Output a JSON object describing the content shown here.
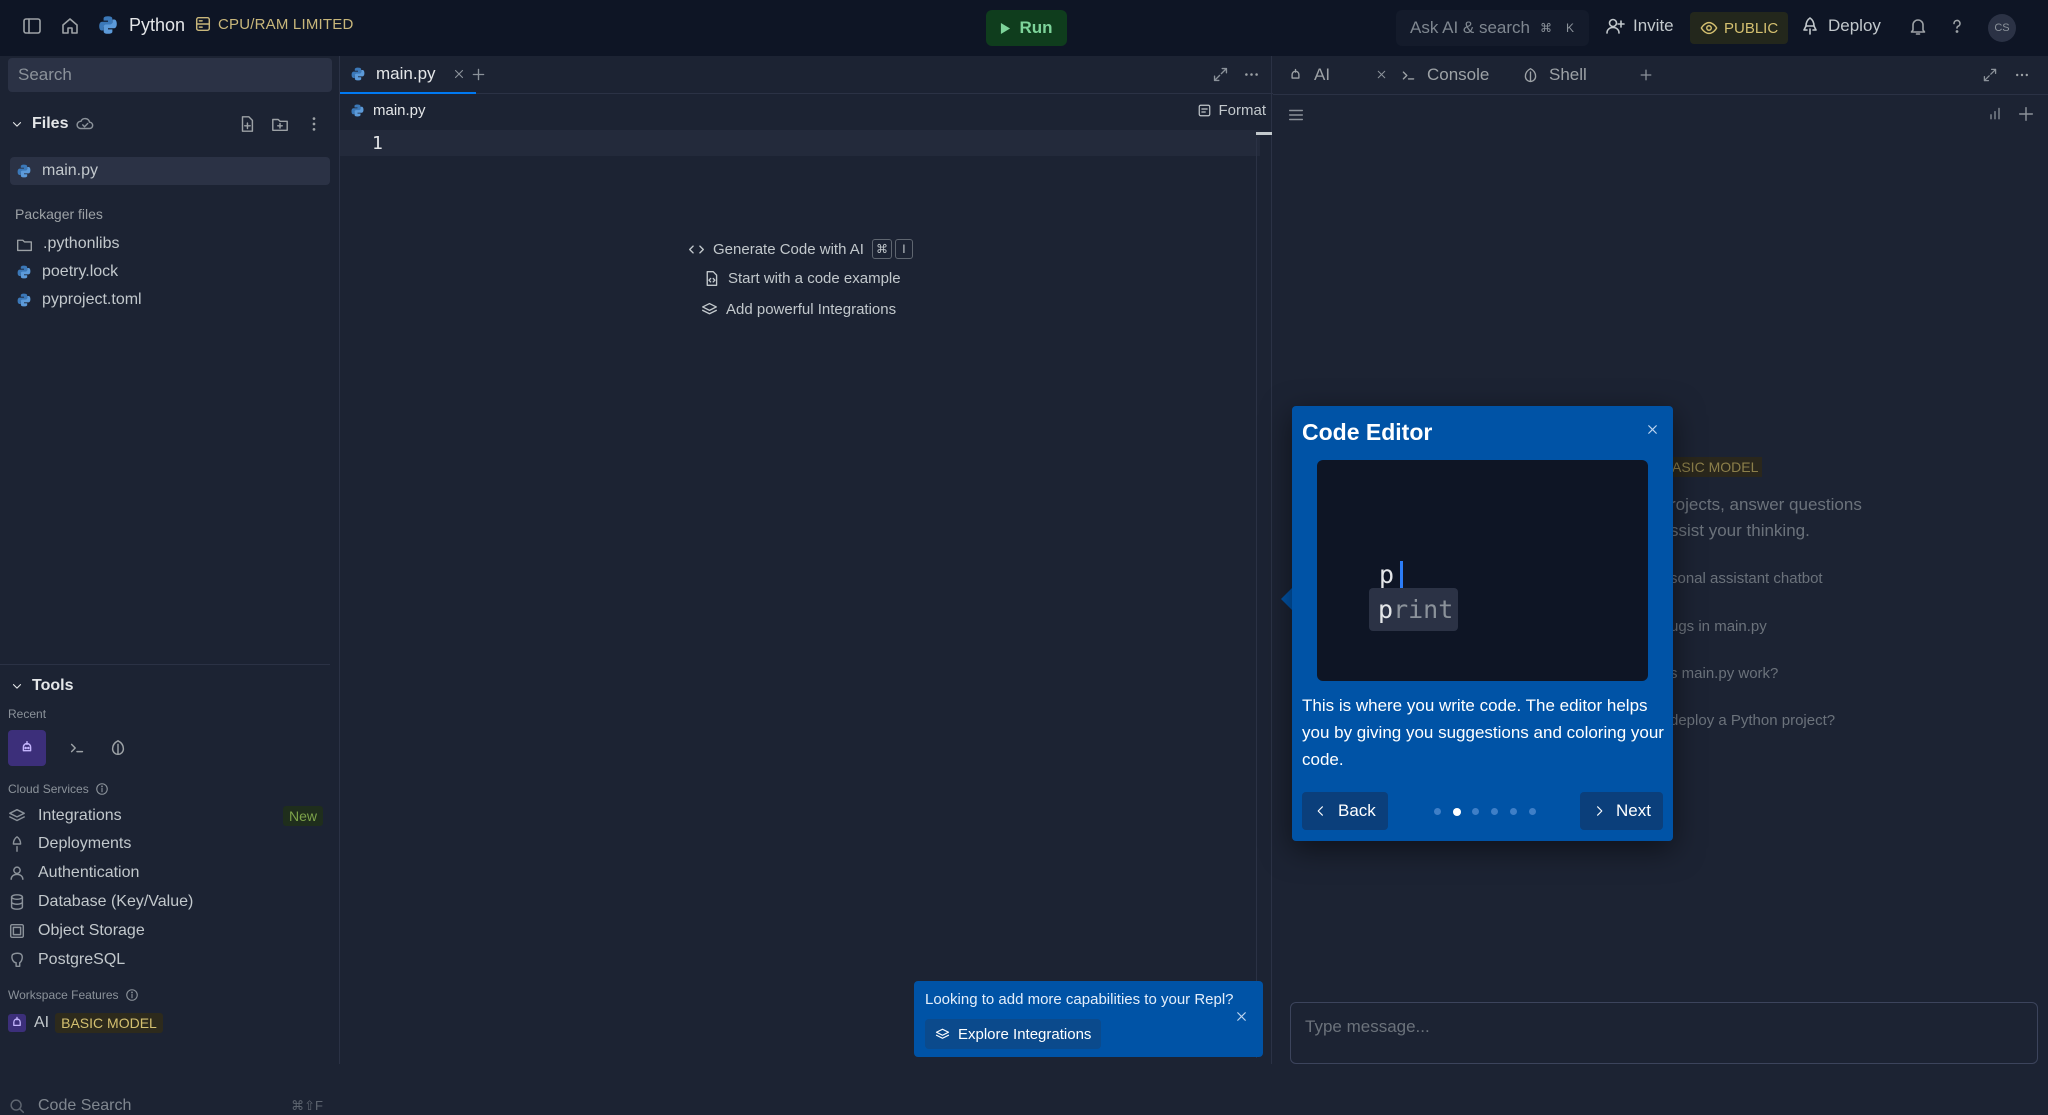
{
  "topbar": {
    "repl_name": "Python",
    "resource_badge": "CPU/RAM LIMITED",
    "run_label": "Run",
    "ask_ai_label": "Ask AI & search",
    "ask_ai_keys": [
      "⌘",
      "K"
    ],
    "invite_label": "Invite",
    "visibility_label": "PUBLIC",
    "deploy_label": "Deploy",
    "avatar_initials": "CS"
  },
  "sidebar": {
    "search_placeholder": "Search",
    "files_title": "Files",
    "files": [
      {
        "name": "main.py",
        "icon": "python-file-icon",
        "selected": true
      }
    ],
    "packager_title": "Packager files",
    "packager_files": [
      {
        "name": ".pythonlibs",
        "icon": "folder-icon"
      },
      {
        "name": "poetry.lock",
        "icon": "python-file-icon"
      },
      {
        "name": "pyproject.toml",
        "icon": "python-file-icon"
      }
    ],
    "tools_title": "Tools",
    "recent_label": "Recent",
    "cloud_services_label": "Cloud Services",
    "cloud_services": [
      {
        "label": "Integrations",
        "badge": "New"
      },
      {
        "label": "Deployments"
      },
      {
        "label": "Authentication"
      },
      {
        "label": "Database (Key/Value)"
      },
      {
        "label": "Object Storage"
      },
      {
        "label": "PostgreSQL"
      }
    ],
    "workspace_features_label": "Workspace Features",
    "workspace_features": [
      {
        "label": "AI",
        "badge": "BASIC MODEL"
      },
      {
        "label": "Code Search",
        "shortcut": "⌘⇧F"
      }
    ]
  },
  "editor": {
    "tab_label": "main.py",
    "breadcrumb": "main.py",
    "format_label": "Format",
    "line_number": "1",
    "actions": [
      {
        "label": "Generate Code with AI",
        "keys": [
          "⌘",
          "I"
        ]
      },
      {
        "label": "Start with a code example"
      },
      {
        "label": "Add powerful Integrations"
      }
    ]
  },
  "toast": {
    "text": "Looking to add more capabilities to your Repl?",
    "button_label": "Explore Integrations"
  },
  "right_pane": {
    "tabs": [
      "AI",
      "Console",
      "Shell"
    ],
    "ghost_badge": "ASIC MODEL",
    "ghost_line1": "rojects, answer questions",
    "ghost_line2": "ssist your thinking.",
    "ghost_suggestions": [
      "sonal assistant chatbot",
      "ugs in main.py",
      "s main.py work?",
      "deploy a Python project?"
    ],
    "message_placeholder": "Type message..."
  },
  "tour": {
    "title": "Code Editor",
    "typed_text": "p",
    "suggestion_match": "p",
    "suggestion_rest": "rint",
    "description": "This is where you write code. The editor helps you by giving you suggestions and coloring your code.",
    "back_label": "Back",
    "next_label": "Next",
    "step_count": 6,
    "current_step": 2
  },
  "colors": {
    "tour_bg": "#0053a6",
    "run_green": "#7dd49a",
    "accent": "#0079f2"
  }
}
